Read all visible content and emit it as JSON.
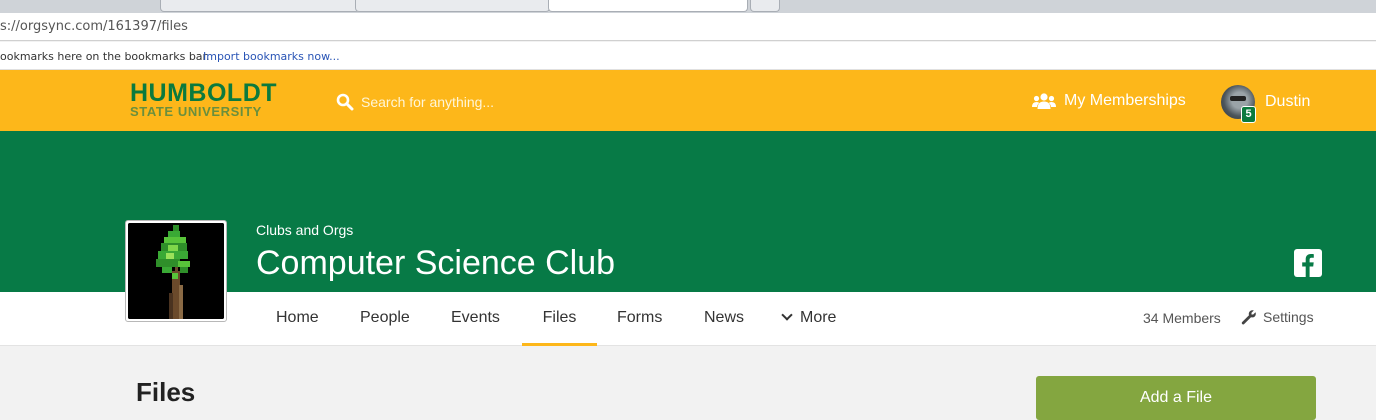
{
  "browser": {
    "url": "s://orgsync.com/161397/files",
    "bookmarks_message": "ookmarks here on the bookmarks bar.",
    "import_link": "Import bookmarks now..."
  },
  "header": {
    "logo_line1": "HUMBOLDT",
    "logo_line2": "STATE UNIVERSITY",
    "search_placeholder": "Search for anything...",
    "memberships_label": "My Memberships",
    "user_name": "Dustin",
    "notification_count": "5"
  },
  "org": {
    "category": "Clubs and Orgs",
    "name": "Computer Science Club"
  },
  "subnav": {
    "items": [
      "Home",
      "People",
      "Events",
      "Files",
      "Forms",
      "News"
    ],
    "more_label": "More",
    "active": "Files",
    "members": "34 Members",
    "settings": "Settings"
  },
  "content": {
    "heading": "Files",
    "add_button": "Add a File"
  },
  "colors": {
    "gold": "#fdb71a",
    "green": "#077a46",
    "button_green": "#84a640"
  },
  "icons": [
    "search-icon",
    "people-icon",
    "facebook-icon",
    "wrench-icon",
    "chevron-down-icon"
  ]
}
